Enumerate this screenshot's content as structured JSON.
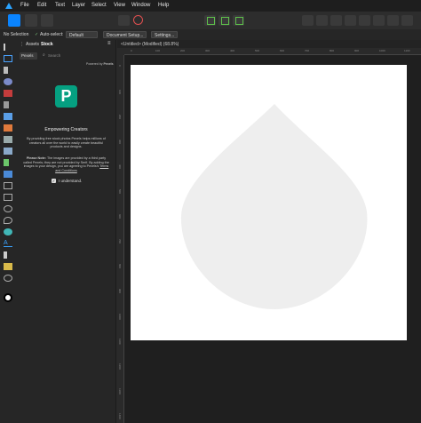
{
  "menubar": {
    "items": [
      "File",
      "Edit",
      "Text",
      "Layer",
      "Select",
      "View",
      "Window",
      "Help"
    ]
  },
  "context_bar": {
    "selection": "No Selection",
    "auto_select_label": "Auto-select:",
    "auto_select_value": "Default",
    "document_setup": "Document Setup...",
    "settings": "Settings..."
  },
  "panel": {
    "tabs": [
      "Assets",
      "Stock"
    ],
    "source": "Pexels",
    "search_placeholder": "Search",
    "powered_by": "Powered by",
    "powered_by_brand": "Pexels",
    "heading": "Empowering Creators",
    "description": "By providing free stock photos Pexels helps millions of creators all over the world to easily create beautiful products and designs.",
    "note_label": "Please Note:",
    "note_text": "The images are provided by a third party called Pexels; they are not provided by Serif. By adding the images to your design, you are agreeing to Pexels's",
    "terms": "Terms and Conditions",
    "understand": "I understand."
  },
  "document": {
    "tab_title": "<Untitled> (Modified) (68.8%)"
  },
  "rulers": {
    "horizontal": [
      "0",
      "100",
      "200",
      "300",
      "400",
      "500",
      "600",
      "700",
      "800",
      "900",
      "1000",
      "1100"
    ],
    "vertical": [
      "0",
      "100",
      "200",
      "300",
      "400",
      "500",
      "600",
      "700",
      "800",
      "900",
      "1000",
      "1100",
      "1200",
      "1300",
      "1400"
    ]
  },
  "colors": {
    "accent": "#0a84ff",
    "pexels_green": "#05a081",
    "shape_fill": "#eeeeee",
    "page": "#ffffff"
  }
}
